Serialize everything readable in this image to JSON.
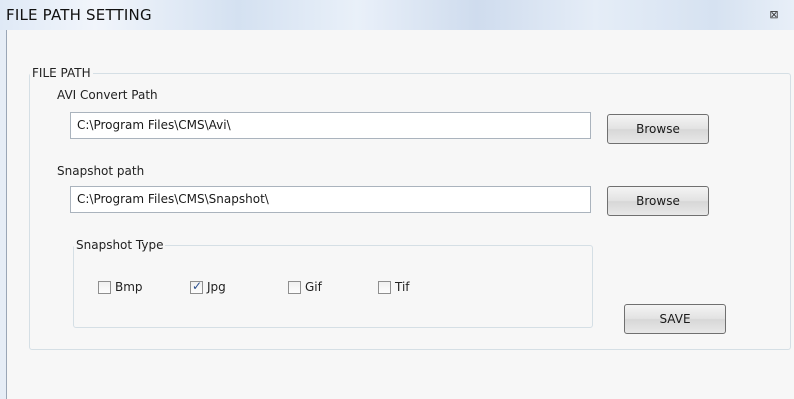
{
  "window": {
    "title": "FILE PATH SETTING",
    "close_glyph": "⊠",
    "close_icon": "close-icon"
  },
  "file_path": {
    "legend": "FILE PATH",
    "avi_label": "AVI Convert  Path",
    "avi_value": "C:\\Program Files\\CMS\\Avi\\",
    "avi_browse": "Browse",
    "snapshot_label": "Snapshot path",
    "snapshot_value": "C:\\Program Files\\CMS\\Snapshot\\",
    "snapshot_browse": "Browse"
  },
  "snapshot_type": {
    "legend": "Snapshot Type",
    "options": [
      {
        "label": "Bmp",
        "checked": false
      },
      {
        "label": "Jpg",
        "checked": true
      },
      {
        "label": "Gif",
        "checked": false
      },
      {
        "label": "Tif",
        "checked": false
      }
    ]
  },
  "save_label": "SAVE"
}
